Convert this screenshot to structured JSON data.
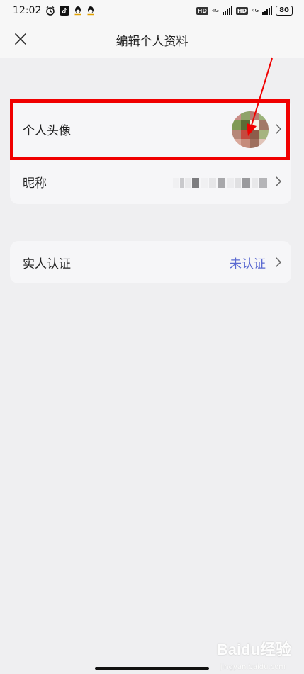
{
  "status_bar": {
    "time": "12:02",
    "battery": "80",
    "network_1": "4G",
    "network_2": "4G"
  },
  "header": {
    "title": "编辑个人资料"
  },
  "profile": {
    "avatar_label": "个人头像",
    "nickname_label": "昵称"
  },
  "verification": {
    "label": "实人认证",
    "status": "未认证",
    "status_color": "#5b6ad1"
  },
  "icons": {
    "close": "close-icon",
    "chevron": "chevron-right-icon"
  },
  "annotation": {
    "highlight_color": "#f00000"
  },
  "watermark": {
    "text": "Baidu经验",
    "url": "jingyan.baidu.com"
  }
}
